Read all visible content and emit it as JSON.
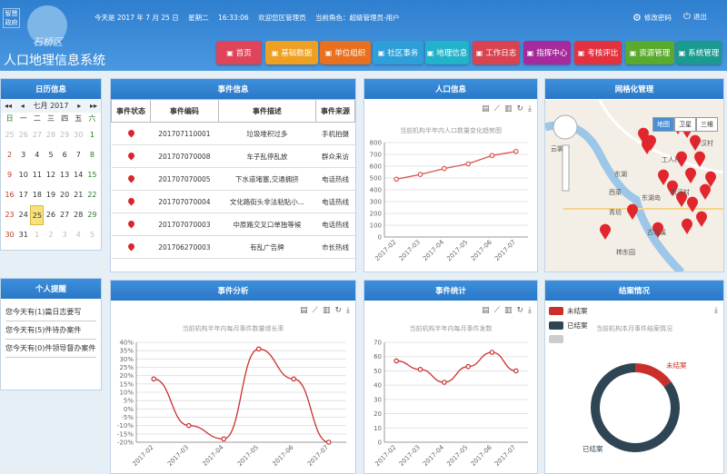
{
  "header": {
    "badge": "智慧政府",
    "logo_text": "石桥区",
    "app_title": "人口地理信息系统",
    "date": "今天是 2017 年 7 月 25 日",
    "weekday": "星期二",
    "time": "16:33:06",
    "welcome": "欢迎您区管理员",
    "role": "当前角色：超级管理员-用户",
    "change_pwd": "修改密码",
    "logout": "退出"
  },
  "nav": [
    {
      "label": "首页",
      "color": "#e0445a"
    },
    {
      "label": "基础数据",
      "color": "#f0a020"
    },
    {
      "label": "单位组织",
      "color": "#e8701e"
    },
    {
      "label": "社区事务",
      "color": "#2e9fd9"
    },
    {
      "label": "地理信息",
      "color": "#21b3c9"
    },
    {
      "label": "工作日志",
      "color": "#d9434f"
    },
    {
      "label": "指挥中心",
      "color": "#a72a9c"
    },
    {
      "label": "考核评比",
      "color": "#e4313e"
    },
    {
      "label": "资源管理",
      "color": "#5aaa2e"
    },
    {
      "label": "系统管理",
      "color": "#1b9a8f"
    }
  ],
  "calendar": {
    "title": "日历信息",
    "month": "七月 2017",
    "weekdays": [
      "日",
      "一",
      "二",
      "三",
      "四",
      "五",
      "六"
    ],
    "days": [
      "25",
      "26",
      "27",
      "28",
      "29",
      "30",
      "1",
      "2",
      "3",
      "4",
      "5",
      "6",
      "7",
      "8",
      "9",
      "10",
      "11",
      "12",
      "13",
      "14",
      "15",
      "16",
      "17",
      "18",
      "19",
      "20",
      "21",
      "22",
      "23",
      "24",
      "25",
      "26",
      "27",
      "28",
      "29",
      "30",
      "31",
      "1",
      "2",
      "3",
      "4",
      "5"
    ],
    "today": "25"
  },
  "reminder": {
    "title": "个人提醒",
    "items": [
      "您今天有(1)篇日志要写",
      "您今天有(5)件待办案件",
      "您今天有(0)件领导督办案件"
    ]
  },
  "events": {
    "title": "事件信息",
    "columns": [
      "事件状态",
      "事件编码",
      "事件描述",
      "事件来源"
    ],
    "rows": [
      {
        "code": "201707110001",
        "desc": "垃圾堆积过多",
        "source": "手机拍摄"
      },
      {
        "code": "201707070008",
        "desc": "车子乱停乱放",
        "source": "群众来访"
      },
      {
        "code": "201707070005",
        "desc": "下水道堵塞,交通拥挤",
        "source": "电话热线"
      },
      {
        "code": "201707070004",
        "desc": "文化路街头非法粘贴小...",
        "source": "电话热线"
      },
      {
        "code": "201707070003",
        "desc": "中原路交叉口单独等候",
        "source": "电话热线"
      },
      {
        "code": "201706270003",
        "desc": "有乱广告牌",
        "source": "市长热线"
      }
    ]
  },
  "population": {
    "title": "人口信息",
    "subtitle": "当前机构半年内人口数量变化趋势图"
  },
  "grid": {
    "title": "网格化管理",
    "map_types": [
      "地图",
      "卫星",
      "三维"
    ],
    "labels": [
      "云裳街",
      "工人村",
      "广汉村",
      "东湖",
      "西菜",
      "东湖岛",
      "新汉村",
      "青坊",
      "古城溪",
      "柿东园"
    ]
  },
  "analysis": {
    "title": "事件分析",
    "subtitle": "当前机构半年内每月事件数量增长率"
  },
  "stats": {
    "title": "事件统计",
    "subtitle": "当前机构半年内每月事件发数"
  },
  "closing": {
    "title": "结案情况",
    "subtitle": "当前机构本月事件结案情况",
    "legend": [
      "未结案",
      "已结案",
      ""
    ],
    "label_open": "未结案",
    "label_closed": "已结案"
  },
  "chart_data": [
    {
      "type": "line",
      "title": "当前机构半年内人口数量变化趋势图",
      "categories": [
        "2017-02",
        "2017-03",
        "2017-04",
        "2017-05",
        "2017-06",
        "2017-07"
      ],
      "values": [
        490,
        530,
        580,
        620,
        690,
        725
      ],
      "ylim": [
        0,
        800
      ],
      "yticks": [
        "0",
        "100",
        "200",
        "300",
        "400",
        "500",
        "600",
        "700",
        "800"
      ],
      "color": "#d9534f"
    },
    {
      "type": "line",
      "title": "当前机构半年内每月事件数量增长率",
      "categories": [
        "2017-02",
        "2017-03",
        "2017-04",
        "2017-05",
        "2017-06",
        "2017-07"
      ],
      "values": [
        18,
        -10,
        -18,
        36,
        18,
        -20
      ],
      "ylim": [
        -20,
        40
      ],
      "yticks": [
        "-20%",
        "-15%",
        "-10%",
        "-5%",
        "0%",
        "5%",
        "10%",
        "15%",
        "20%",
        "25%",
        "30%",
        "35%",
        "40%"
      ],
      "color": "#c9302c"
    },
    {
      "type": "line",
      "title": "当前机构半年内每月事件发数",
      "categories": [
        "2017-02",
        "2017-03",
        "2017-04",
        "2017-05",
        "2017-06",
        "2017-07"
      ],
      "values": [
        57,
        51,
        42,
        53,
        63,
        50
      ],
      "ylim": [
        0,
        70
      ],
      "yticks": [
        "0",
        "10",
        "20",
        "30",
        "40",
        "50",
        "60",
        "70"
      ],
      "color": "#c9302c"
    },
    {
      "type": "pie",
      "title": "当前机构本月事件结案情况",
      "categories": [
        "未结案",
        "已结案"
      ],
      "values": [
        15,
        85
      ],
      "colors": [
        "#c9302c",
        "#2f4554"
      ]
    }
  ],
  "colors": {
    "header": "#2f7fd0",
    "panel_head": "#2a78c8",
    "pin": "#d9262c",
    "today": "#f7e17a"
  }
}
